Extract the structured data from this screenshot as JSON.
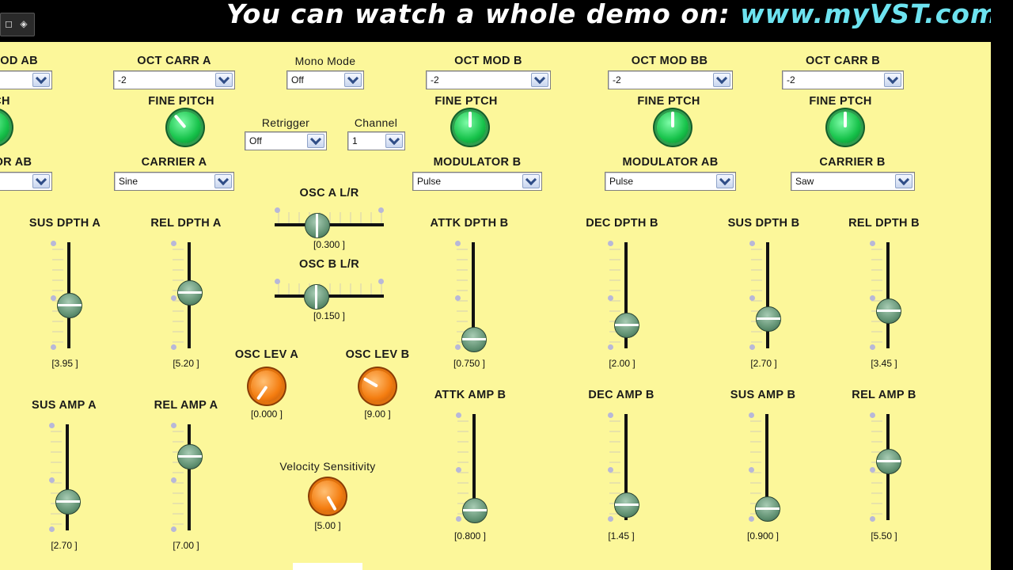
{
  "banner": {
    "prefix": "You can watch a whole demo on:",
    "url": "www.myVST.com"
  },
  "dropdowns": [
    {
      "id": "dd-oct-mod-ab",
      "label": "OCT MOD AB",
      "value": ""
    },
    {
      "id": "dd-oct-carr-a",
      "label": "OCT CARR A",
      "value": "-2"
    },
    {
      "id": "dd-mono-mode",
      "label": "Mono Mode",
      "value": "Off"
    },
    {
      "id": "dd-oct-mod-b",
      "label": "OCT MOD B",
      "value": "-2"
    },
    {
      "id": "dd-oct-mod-bb",
      "label": "OCT MOD BB",
      "value": "-2"
    },
    {
      "id": "dd-oct-carr-b",
      "label": "OCT CARR B",
      "value": "-2"
    },
    {
      "id": "dd-retrigger",
      "label": "Retrigger",
      "value": "Off"
    },
    {
      "id": "dd-channel",
      "label": "Channel",
      "value": "1"
    },
    {
      "id": "dd-modulator-ab-left",
      "label": "TOR AB",
      "value": ""
    },
    {
      "id": "dd-carrier-a",
      "label": "CARRIER A",
      "value": "Sine"
    },
    {
      "id": "dd-modulator-b",
      "label": "MODULATOR B",
      "value": "Pulse"
    },
    {
      "id": "dd-modulator-ab",
      "label": "MODULATOR AB",
      "value": "Pulse"
    },
    {
      "id": "dd-carrier-b",
      "label": "CARRIER B",
      "value": "Saw"
    }
  ],
  "knobs": [
    {
      "id": "knob-fine-pitch-left",
      "label": "CH"
    },
    {
      "id": "knob-fine-pitch-a",
      "label": "FINE PITCH"
    },
    {
      "id": "knob-fine-ptch-b",
      "label": "FINE PTCH"
    },
    {
      "id": "knob-fine-ptch-bb",
      "label": "FINE PTCH"
    },
    {
      "id": "knob-fine-ptch-c",
      "label": "FINE PTCH"
    },
    {
      "id": "knob-osc-lev-a",
      "label": "OSC LEV A",
      "value": "0.000"
    },
    {
      "id": "knob-osc-lev-b",
      "label": "OSC LEV B",
      "value": "9.00"
    },
    {
      "id": "knob-velocity",
      "label": "Velocity Sensitivity",
      "value": "5.00"
    }
  ],
  "hsliders": [
    {
      "id": "hs-osc-a-lr",
      "label": "OSC A L/R",
      "value": "0.300"
    },
    {
      "id": "hs-osc-b-lr",
      "label": "OSC B L/R",
      "value": "0.150"
    }
  ],
  "vsliders": [
    {
      "id": "vs-sus-dpth-a",
      "label": "SUS DPTH A",
      "value": "3.95"
    },
    {
      "id": "vs-rel-dpth-a",
      "label": "REL DPTH A",
      "value": "5.20"
    },
    {
      "id": "vs-attk-dpth-b",
      "label": "ATTK DPTH B",
      "value": "0.750"
    },
    {
      "id": "vs-dec-dpth-b",
      "label": "DEC DPTH B",
      "value": "2.00"
    },
    {
      "id": "vs-sus-dpth-b",
      "label": "SUS DPTH B",
      "value": "2.70"
    },
    {
      "id": "vs-rel-dpth-b",
      "label": "REL DPTH B",
      "value": "3.45"
    },
    {
      "id": "vs-sus-amp-a",
      "label": "SUS AMP A",
      "value": "2.70"
    },
    {
      "id": "vs-rel-amp-a",
      "label": "REL AMP  A",
      "value": "7.00"
    },
    {
      "id": "vs-attk-amp-b",
      "label": "ATTK AMP B",
      "value": "0.800"
    },
    {
      "id": "vs-dec-amp-b",
      "label": "DEC AMP  B",
      "value": "1.45"
    },
    {
      "id": "vs-sus-amp-b",
      "label": "SUS AMP B",
      "value": "0.900"
    },
    {
      "id": "vs-rel-amp-b",
      "label": "REL AMP  B",
      "value": "5.50"
    }
  ],
  "icons": {
    "toolbar_left": "square-icon",
    "toolbar_right": "diamond-icon"
  },
  "colors": {
    "panel": "#fcf79a",
    "banner_url": "#6de3f0"
  }
}
